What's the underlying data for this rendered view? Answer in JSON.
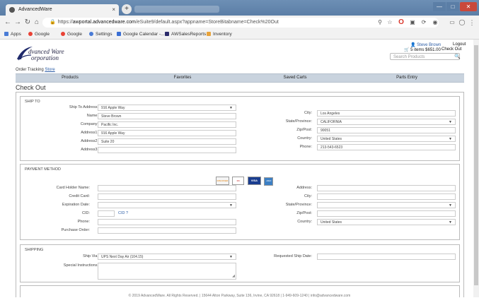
{
  "browser": {
    "tab_title": "AdvancedWare",
    "tab_close": "×",
    "new_tab": "+",
    "url_protocol": "https://",
    "url_host": "awportal.advancedware.com",
    "url_path": "/eSuite9/default.aspx?appname=StoreBitabname=Check%20Out",
    "bookmarks": [
      "Apps",
      "Google",
      "Google",
      "Settings",
      "Google Calendar -...",
      "AWSalesReports",
      "Inventory"
    ]
  },
  "header": {
    "logo_line1": "dvanced Ware",
    "logo_line2": "orporation",
    "crumb_1": "Order Tracking",
    "crumb_2": "Store",
    "user_name": "Steve Brown",
    "logout": "Logout",
    "cart_summary": "5 items $651.00",
    "checkout": "Check Out",
    "search_placeholder": "Search Products"
  },
  "menu": [
    "Products",
    "Favorites",
    "Saved Carts",
    "Parts Entry"
  ],
  "page_title": "Check Out",
  "ship_to": {
    "title": "SHIP TO",
    "left": [
      {
        "label": "Ship To Address:",
        "value": "916 Apple Way",
        "select": true
      },
      {
        "label": "Name:",
        "value": "Steve Brown"
      },
      {
        "label": "Company:",
        "value": "Pacific Inc."
      },
      {
        "label": "Address1:",
        "value": "916 Apple Way"
      },
      {
        "label": "Address2:",
        "value": "Suite 20"
      },
      {
        "label": "Address3:",
        "value": ""
      }
    ],
    "right": [
      {
        "label": "City:",
        "value": "Los Angeles"
      },
      {
        "label": "State/Province:",
        "value": "CALIFORNIA",
        "select": true
      },
      {
        "label": "Zip/Post:",
        "value": "90051"
      },
      {
        "label": "Country:",
        "value": "United States",
        "select": true
      },
      {
        "label": "Phone:",
        "value": "213-543-6523"
      }
    ]
  },
  "payment": {
    "title": "PAYMENT METHOD",
    "cards": [
      "DISCOVER",
      "MC",
      "VISA",
      "AMEX"
    ],
    "left": [
      {
        "label": "Card Holder Name:",
        "value": ""
      },
      {
        "label": "Credit Card:",
        "value": ""
      },
      {
        "label": "Expiration Date:",
        "value": "",
        "select": true
      },
      {
        "label": "CID:",
        "value": "",
        "short": true
      },
      {
        "label": "Phone:",
        "value": ""
      },
      {
        "label": "Purchase Order:",
        "value": ""
      }
    ],
    "cid_help": "CID ?",
    "right": [
      {
        "label": "Address:",
        "value": ""
      },
      {
        "label": "City:",
        "value": ""
      },
      {
        "label": "State/Province:",
        "value": "",
        "select": true
      },
      {
        "label": "Zip/Post:",
        "value": ""
      },
      {
        "label": "Country:",
        "value": "United States",
        "select": true
      }
    ]
  },
  "shipping": {
    "title": "SHIPPING",
    "ship_via_label": "Ship Via:",
    "ship_via_value": "UPS Next Day Air (104.15)",
    "instructions_label": "Special Instructions:",
    "requested_label": "Requested Ship Date:"
  },
  "footer": "© 2019 AdvancedWare. All Rights Reserved. | 15644 Alton Parkway, Suite 136, Irvine, CA 92618 | 1-949-609-1240 | info@advancedware.com"
}
